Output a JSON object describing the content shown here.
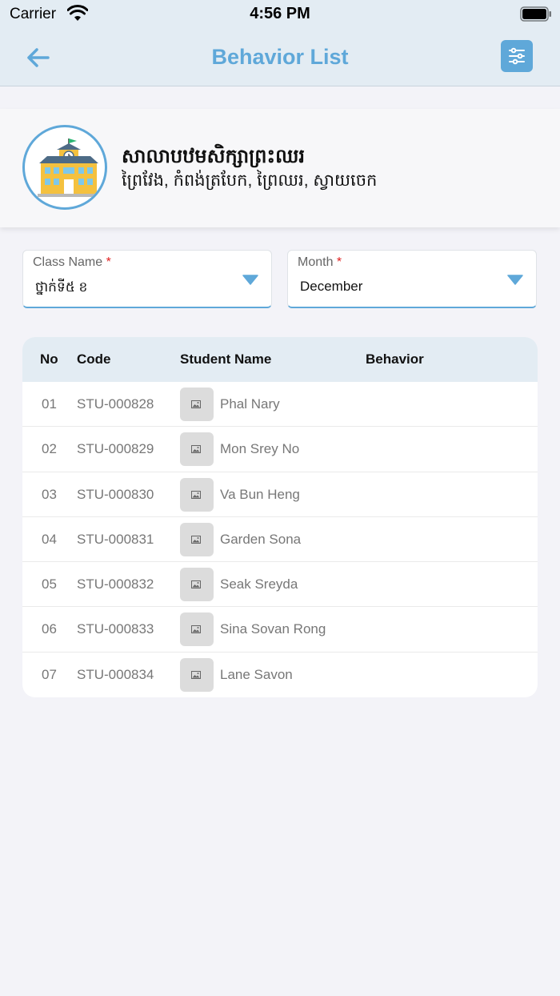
{
  "status_bar": {
    "carrier": "Carrier",
    "time": "4:56 PM"
  },
  "nav": {
    "title": "Behavior List",
    "back_icon": "arrow-left-icon",
    "filter_icon": "sliders-icon"
  },
  "school": {
    "name": "សាលាបឋមសិក្សាព្រះឈរ",
    "address": "ព្រៃវែង, កំពង់ត្របែក, ព្រៃឈរ, ស្វាយចេក"
  },
  "filters": {
    "class": {
      "label": "Class Name",
      "required_mark": "*",
      "value": "ថ្នាក់ទី៥ ខ"
    },
    "month": {
      "label": "Month",
      "required_mark": "*",
      "value": "December"
    }
  },
  "table": {
    "headers": {
      "no": "No",
      "code": "Code",
      "student_name": "Student Name",
      "behavior": "Behavior"
    },
    "rows": [
      {
        "no": "01",
        "code": "STU-000828",
        "name": "Phal Nary",
        "behavior": ""
      },
      {
        "no": "02",
        "code": "STU-000829",
        "name": "Mon Srey No",
        "behavior": ""
      },
      {
        "no": "03",
        "code": "STU-000830",
        "name": "Va Bun Heng",
        "behavior": ""
      },
      {
        "no": "04",
        "code": "STU-000831",
        "name": "Garden Sona",
        "behavior": ""
      },
      {
        "no": "05",
        "code": "STU-000832",
        "name": "Seak Sreyda",
        "behavior": ""
      },
      {
        "no": "06",
        "code": "STU-000833",
        "name": "Sina Sovan Rong",
        "behavior": ""
      },
      {
        "no": "07",
        "code": "STU-000834",
        "name": "Lane Savon",
        "behavior": ""
      }
    ]
  },
  "colors": {
    "accent": "#5fa8d9",
    "header_bg": "#e3ecf3",
    "required": "#e02020"
  }
}
